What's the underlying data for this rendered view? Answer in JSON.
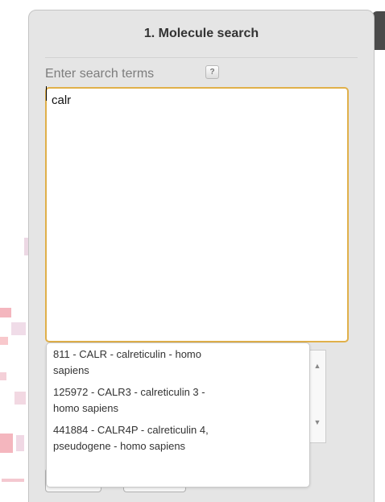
{
  "panel": {
    "title": "1. Molecule search",
    "field_label": "Enter search terms",
    "help_icon": "?",
    "search_value": "calr"
  },
  "autocomplete": {
    "items": [
      {
        "line1": "811 - CALR - calreticulin - homo",
        "line2": "sapiens"
      },
      {
        "line1": "125972 - CALR3 - calreticulin 3 -",
        "line2": "homo sapiens"
      },
      {
        "line1": "441884 - CALR4P - calreticulin 4,",
        "line2": "pseudogene - homo sapiens"
      }
    ]
  },
  "scrollbar": {
    "up_icon": "▲",
    "down_icon": "▼"
  },
  "colors": {
    "panel_bg": "#e5e5e5",
    "focus_border": "#e0b04a",
    "label_text": "#7d7d7d"
  }
}
